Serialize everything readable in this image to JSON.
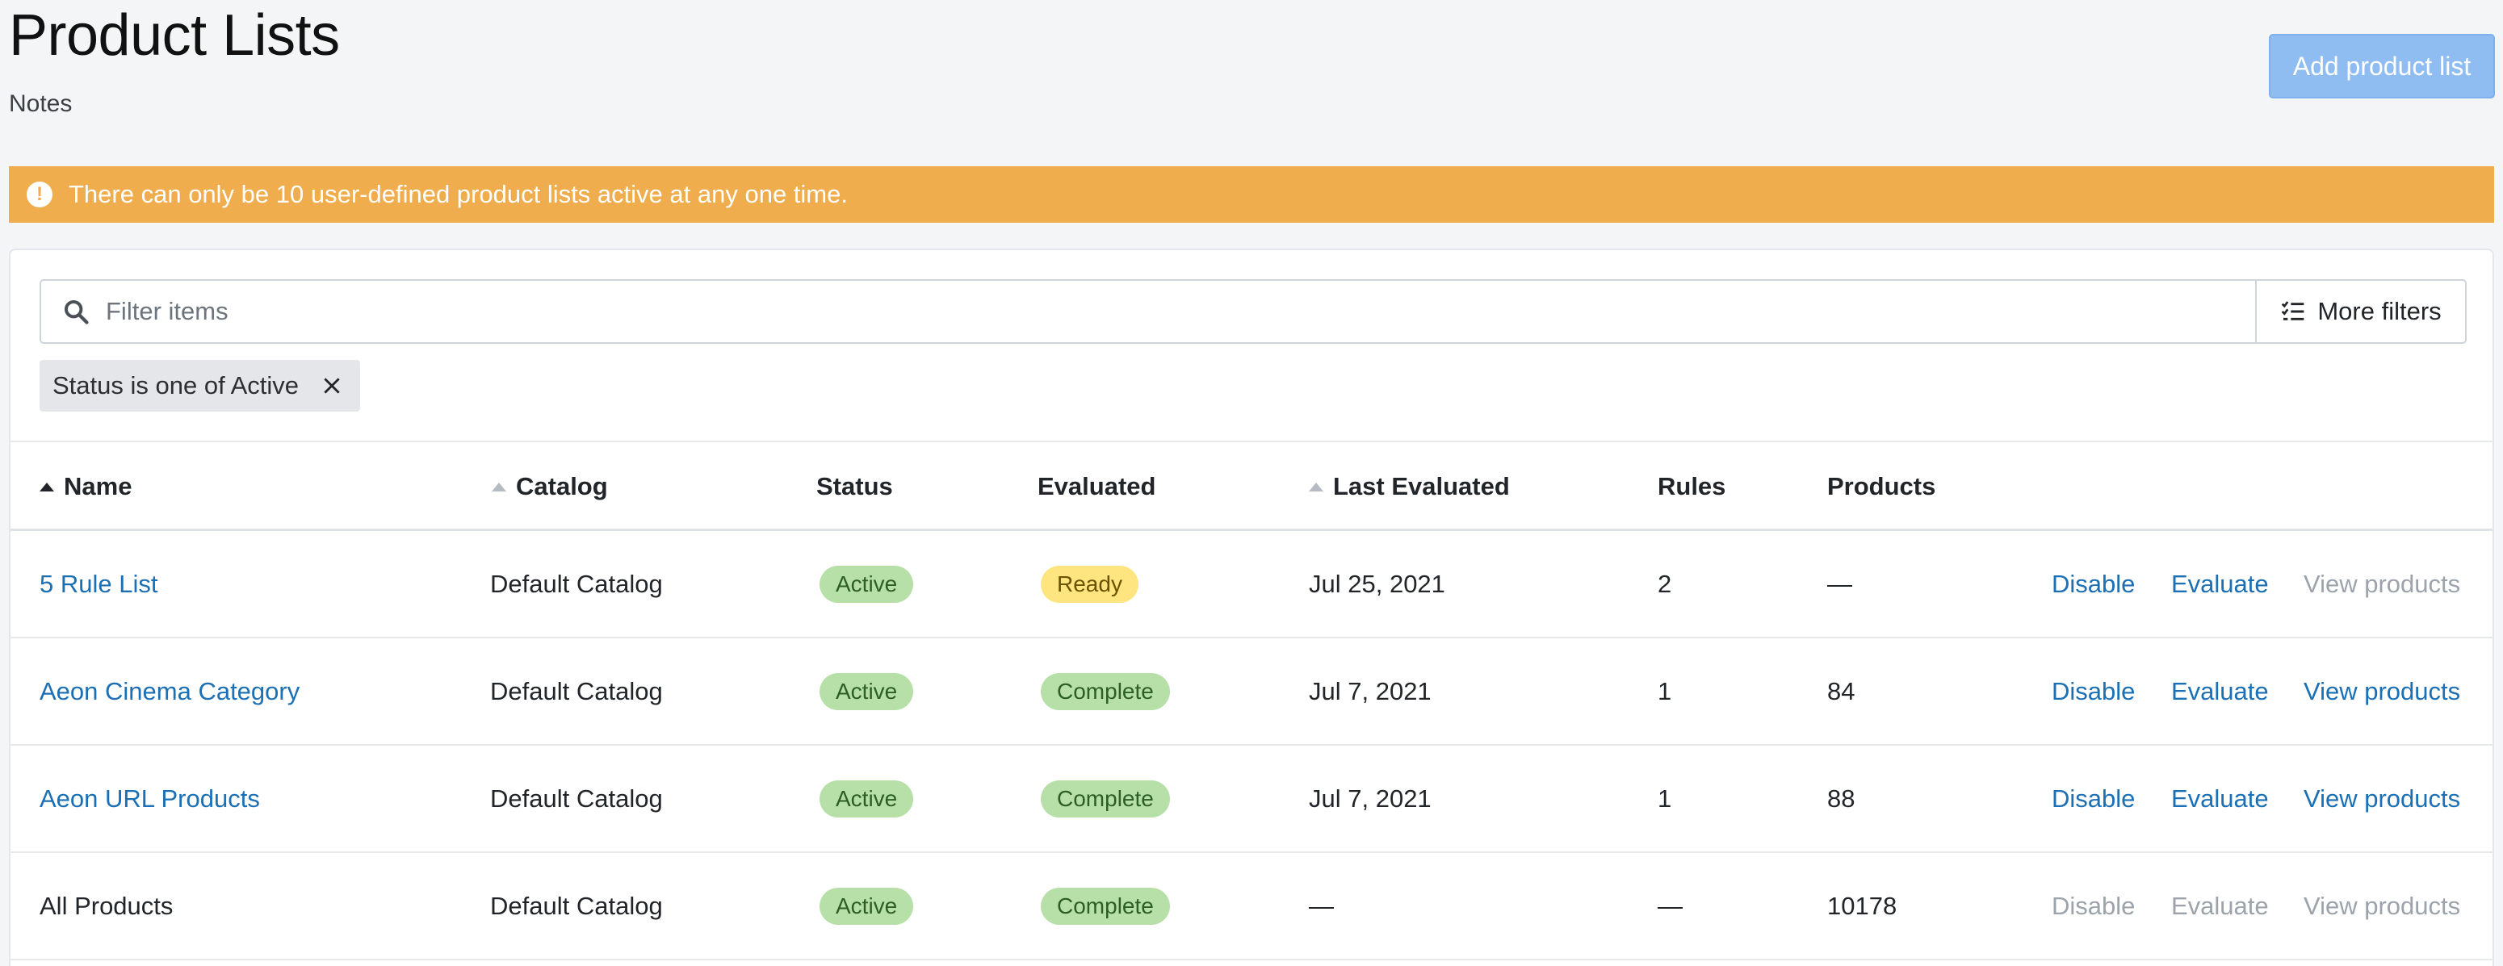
{
  "header": {
    "title": "Product Lists",
    "notes": "Notes",
    "add_button": "Add product list"
  },
  "alert": {
    "icon": "exclamation-circle-icon",
    "message": "There can only be 10 user-defined product lists active at any one time.",
    "color": "#f0ad4e"
  },
  "filters": {
    "search_placeholder": "Filter items",
    "more_filters_label": "More filters",
    "active_chip": "Status is one of Active"
  },
  "table": {
    "columns": {
      "name": "Name",
      "catalog": "Catalog",
      "status": "Status",
      "evaluated": "Evaluated",
      "last_evaluated": "Last Evaluated",
      "rules": "Rules",
      "products": "Products"
    },
    "sort": {
      "column": "name",
      "direction": "ascending"
    },
    "rows": [
      {
        "name": "5 Rule List",
        "name_link": true,
        "catalog": "Default Catalog",
        "status": "Active",
        "evaluated": "Ready",
        "evaluated_style": "yellow",
        "last_evaluated": "Jul 25, 2021",
        "rules": "2",
        "products": "—",
        "actions": {
          "disable": "Disable",
          "evaluate": "Evaluate",
          "view": "View products"
        },
        "actions_enabled": {
          "disable": true,
          "evaluate": true,
          "view": false
        }
      },
      {
        "name": "Aeon Cinema Category",
        "name_link": true,
        "catalog": "Default Catalog",
        "status": "Active",
        "evaluated": "Complete",
        "evaluated_style": "green",
        "last_evaluated": "Jul 7, 2021",
        "rules": "1",
        "products": "84",
        "actions": {
          "disable": "Disable",
          "evaluate": "Evaluate",
          "view": "View products"
        },
        "actions_enabled": {
          "disable": true,
          "evaluate": true,
          "view": true
        }
      },
      {
        "name": "Aeon URL Products",
        "name_link": true,
        "catalog": "Default Catalog",
        "status": "Active",
        "evaluated": "Complete",
        "evaluated_style": "green",
        "last_evaluated": "Jul 7, 2021",
        "rules": "1",
        "products": "88",
        "actions": {
          "disable": "Disable",
          "evaluate": "Evaluate",
          "view": "View products"
        },
        "actions_enabled": {
          "disable": true,
          "evaluate": true,
          "view": true
        }
      },
      {
        "name": "All Products",
        "name_link": false,
        "catalog": "Default Catalog",
        "status": "Active",
        "evaluated": "Complete",
        "evaluated_style": "green",
        "last_evaluated": "—",
        "rules": "—",
        "products": "10178",
        "actions": {
          "disable": "Disable",
          "evaluate": "Evaluate",
          "view": "View products"
        },
        "actions_enabled": {
          "disable": false,
          "evaluate": false,
          "view": false
        }
      }
    ]
  },
  "colors": {
    "link": "#1a6fb5",
    "disabled_link": "#9ca3ab",
    "status_green_bg": "#b6e0a8",
    "status_yellow_bg": "#ffe57f",
    "primary_button": "#8fbdf2"
  }
}
